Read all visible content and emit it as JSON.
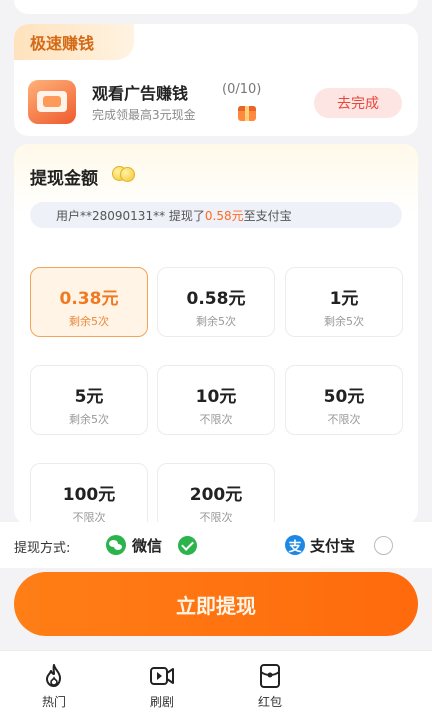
{
  "quick_earn": {
    "tag": "极速赚钱",
    "ad": {
      "title": "观看广告赚钱",
      "count": "(0/10)",
      "subtitle": "完成领最高3元现金",
      "action": "去完成"
    }
  },
  "withdraw": {
    "title": "提现金额",
    "notice": {
      "prefix": "用户**28090131** 提现了",
      "amount": "0.58元",
      "suffix": "至支付宝"
    },
    "options": [
      {
        "amount": "0.38元",
        "sub": "剩余5次",
        "selected": true
      },
      {
        "amount": "0.58元",
        "sub": "剩余5次",
        "selected": false
      },
      {
        "amount": "1元",
        "sub": "剩余5次",
        "selected": false
      },
      {
        "amount": "5元",
        "sub": "剩余5次",
        "selected": false
      },
      {
        "amount": "10元",
        "sub": "不限次",
        "selected": false
      },
      {
        "amount": "50元",
        "sub": "不限次",
        "selected": false
      },
      {
        "amount": "100元",
        "sub": "不限次",
        "selected": false
      },
      {
        "amount": "200元",
        "sub": "不限次",
        "selected": false
      }
    ]
  },
  "payment": {
    "label": "提现方式:",
    "methods": [
      {
        "name": "微信",
        "icon": "wechat-icon",
        "checked": true
      },
      {
        "name": "支付宝",
        "icon": "alipay-icon",
        "checked": false
      }
    ]
  },
  "withdraw_button": "立即提现",
  "tabs": [
    {
      "label": "热门",
      "icon": "flame-icon"
    },
    {
      "label": "刷剧",
      "icon": "video-icon"
    },
    {
      "label": "红包",
      "icon": "red-envelope-icon"
    }
  ],
  "colors": {
    "accent": "#ff7a1a",
    "selected_border": "#f2a45a",
    "wechat": "#2bb34c",
    "alipay": "#1e88e5"
  }
}
